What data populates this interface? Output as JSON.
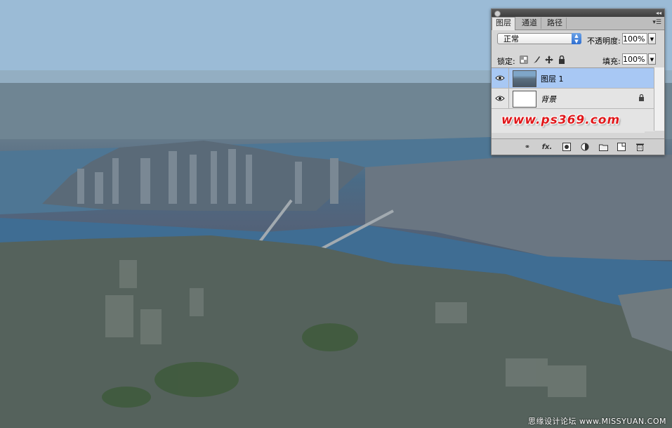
{
  "watermark": {
    "bottom_right": "思缘设计论坛 www.MISSYUAN.COM"
  },
  "panel": {
    "tabs": [
      {
        "label": "图层",
        "active": true
      },
      {
        "label": "通道",
        "active": false
      },
      {
        "label": "路径",
        "active": false
      }
    ],
    "blend_mode": "正常",
    "opacity_label": "不透明度:",
    "opacity_value": "100%",
    "lock_label": "锁定:",
    "fill_label": "填充:",
    "fill_value": "100%",
    "layers": [
      {
        "name": "图层 1",
        "selected": true,
        "visible": true,
        "thumbnail": "photo"
      },
      {
        "name": "背景",
        "selected": false,
        "visible": true,
        "thumbnail": "white",
        "locked": true
      }
    ],
    "brand_text": "www.ps369.com",
    "bottom_icons": [
      "link-icon",
      "fx-icon",
      "mask-icon",
      "adjustment-icon",
      "group-folder-icon",
      "new-layer-icon",
      "trash-icon"
    ],
    "colors": {
      "selected_row": "#a8c8f4",
      "brand_red": "#e0181b"
    }
  }
}
